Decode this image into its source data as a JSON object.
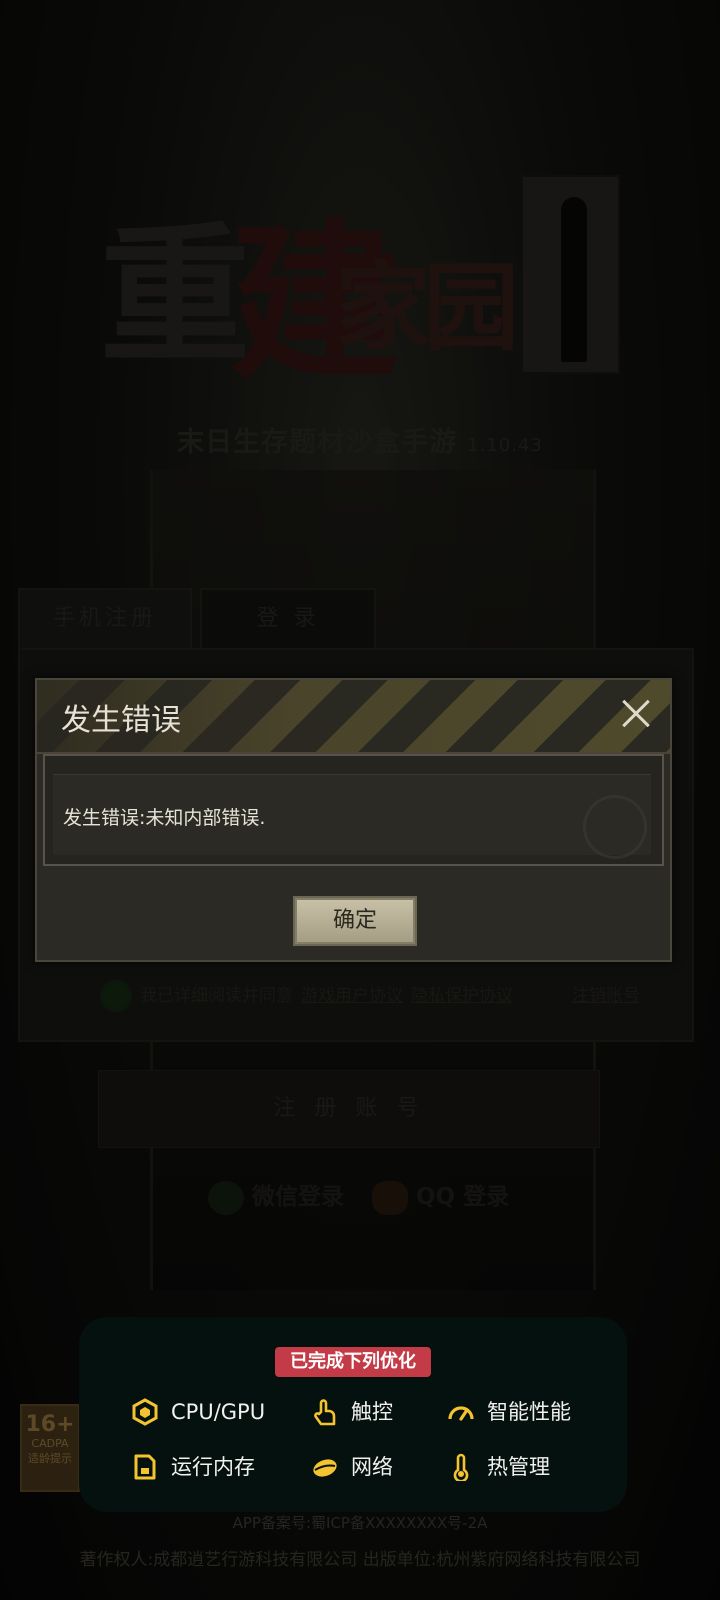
{
  "background": {
    "logo": {
      "char1": "重",
      "char2": "建",
      "char3": "家园"
    },
    "subtitle": "末日生存题材沙盒手游",
    "version": "1.10.43",
    "tabs": {
      "register": "手机注册",
      "login": "登 录"
    },
    "agreement": {
      "text": "我已详细阅读并同意",
      "user_agreement": "游戏用户协议",
      "privacy": "隐私保护协议",
      "cancel_account": "注销账号"
    },
    "register_button": "注 册 账 号",
    "social": {
      "wechat": "微信登录",
      "qq": "QQ 登录"
    },
    "age_badge": {
      "rating": "16+",
      "org": "CADPA",
      "note": "适龄提示"
    },
    "filing": "APP备案号:蜀ICP备XXXXXXXX号-2A",
    "copyright": "著作权人:成都逍艺行游科技有限公司 出版单位:杭州紫府网络科技有限公司"
  },
  "dialog": {
    "title": "发生错误",
    "message": "发生错误:未知内部错误.",
    "confirm": "确定"
  },
  "toast": {
    "badge": "已完成下列优化",
    "items": [
      {
        "label": "CPU/GPU",
        "icon": "chip-icon"
      },
      {
        "label": "触控",
        "icon": "touch-icon"
      },
      {
        "label": "智能性能",
        "icon": "speedometer-icon"
      },
      {
        "label": "运行内存",
        "icon": "memory-icon"
      },
      {
        "label": "网络",
        "icon": "network-icon"
      },
      {
        "label": "热管理",
        "icon": "thermometer-icon"
      }
    ],
    "accent_color": "#f4c430",
    "badge_color": "#c33b47"
  }
}
